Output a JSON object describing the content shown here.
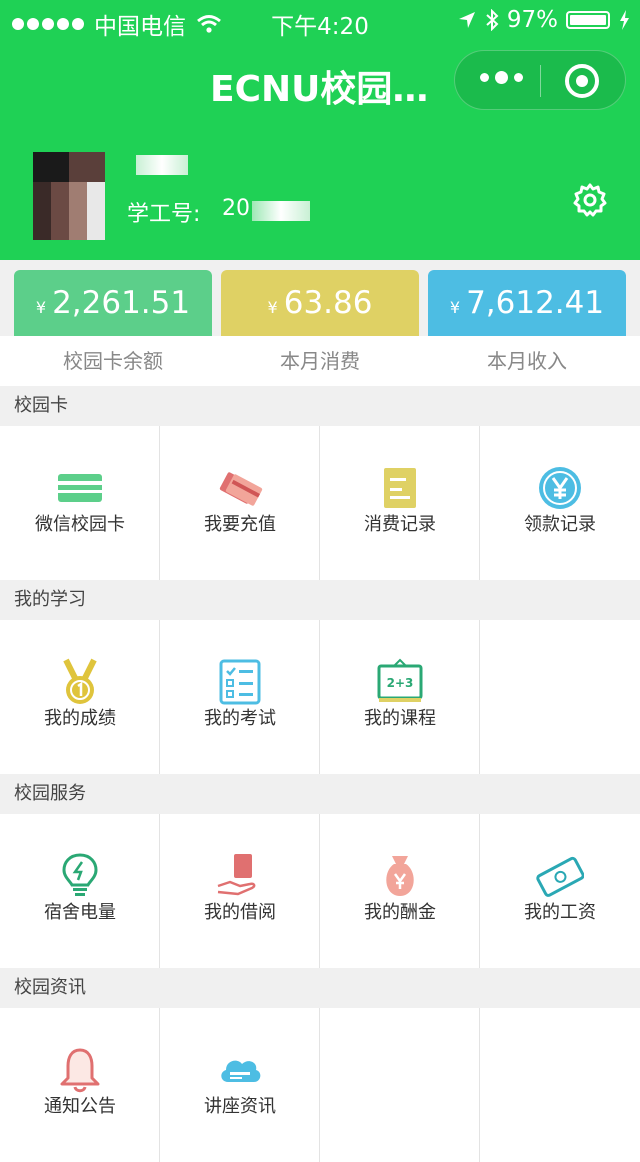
{
  "status_bar": {
    "carrier": "中国电信",
    "time": "下午4:20",
    "battery": "97%"
  },
  "nav": {
    "title": "ECNU校园…"
  },
  "profile": {
    "id_label": "学工号:",
    "id_value": "20"
  },
  "balances": [
    {
      "currency": "¥",
      "value": "2,261.51",
      "label": "校园卡余额",
      "color": "#5ccf8a"
    },
    {
      "currency": "¥",
      "value": "63.86",
      "label": "本月消费",
      "color": "#dfd164"
    },
    {
      "currency": "¥",
      "value": "7,612.41",
      "label": "本月收入",
      "color": "#4dbde3"
    }
  ],
  "sections": [
    {
      "title": "校园卡",
      "items": [
        {
          "label": "微信校园卡",
          "icon": "card-icon"
        },
        {
          "label": "我要充值",
          "icon": "recharge-card-icon"
        },
        {
          "label": "消费记录",
          "icon": "record-book-icon"
        },
        {
          "label": "领款记录",
          "icon": "yen-coin-icon"
        }
      ]
    },
    {
      "title": "我的学习",
      "items": [
        {
          "label": "我的成绩",
          "icon": "medal-icon"
        },
        {
          "label": "我的考试",
          "icon": "checklist-icon"
        },
        {
          "label": "我的课程",
          "icon": "blackboard-icon"
        }
      ]
    },
    {
      "title": "校园服务",
      "items": [
        {
          "label": "宿舍电量",
          "icon": "lightbulb-icon"
        },
        {
          "label": "我的借阅",
          "icon": "hand-book-icon"
        },
        {
          "label": "我的酬金",
          "icon": "money-bag-icon"
        },
        {
          "label": "我的工资",
          "icon": "banknote-icon"
        }
      ]
    },
    {
      "title": "校园资讯",
      "items": [
        {
          "label": "通知公告",
          "icon": "bell-icon"
        },
        {
          "label": "讲座资讯",
          "icon": "cloud-chat-icon"
        }
      ]
    }
  ]
}
